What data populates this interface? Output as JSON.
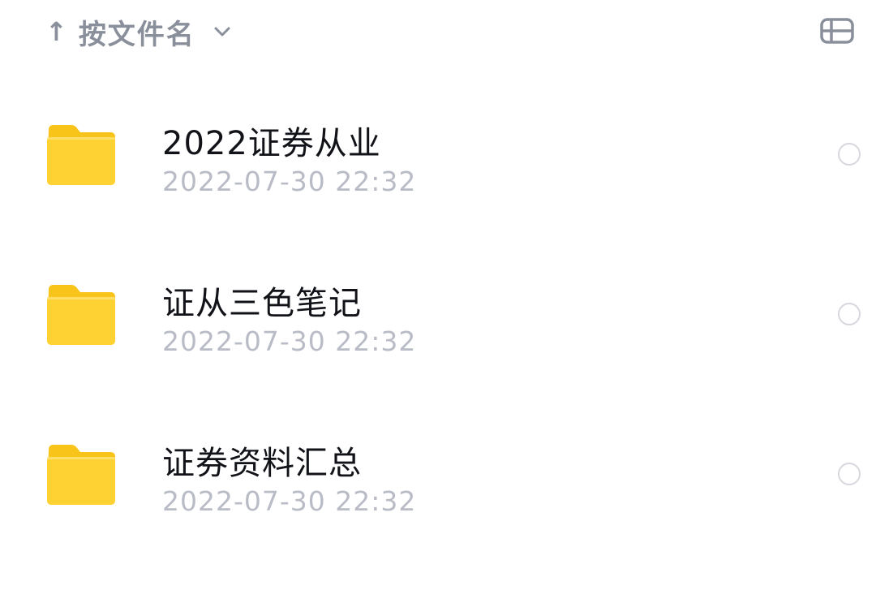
{
  "toolbar": {
    "sort_arrow": "↑",
    "sort_label": "按文件名",
    "sort_chevron_icon": "chevron-down-icon",
    "view_toggle_icon": "view-toggle-icon"
  },
  "files": [
    {
      "name": "2022证券从业",
      "time": "2022-07-30 22:32",
      "icon": "folder-icon"
    },
    {
      "name": "证从三色笔记",
      "time": "2022-07-30 22:32",
      "icon": "folder-icon"
    },
    {
      "name": "证券资料汇总",
      "time": "2022-07-30 22:32",
      "icon": "folder-icon"
    }
  ],
  "colors": {
    "folder": "#FFD233",
    "folder_back": "#F9C41A",
    "muted_text": "#8A8F9C",
    "time_text": "#B9BCC6",
    "name_text": "#111318"
  }
}
